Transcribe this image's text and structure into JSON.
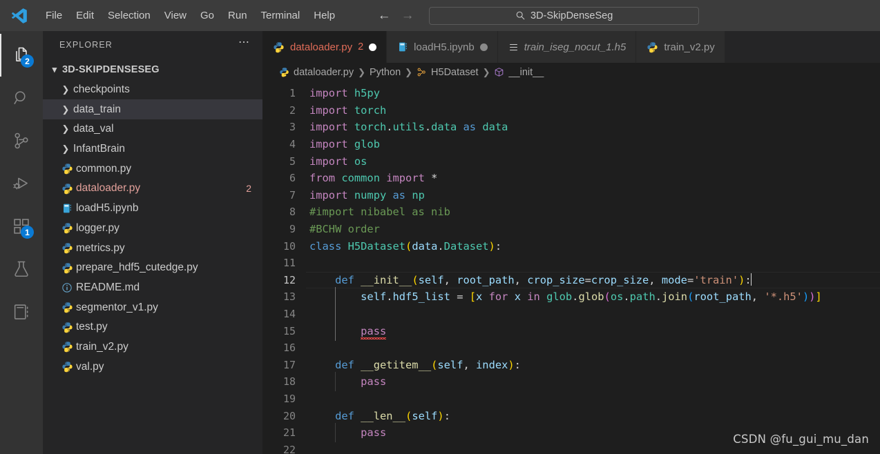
{
  "titlebar": {
    "logo_icon": "vscode-logo-icon",
    "menus": [
      "File",
      "Edit",
      "Selection",
      "View",
      "Go",
      "Run",
      "Terminal",
      "Help"
    ],
    "nav_back_icon": "arrow-left-icon",
    "nav_forward_icon": "arrow-right-icon",
    "quickinput": {
      "search_icon": "search-icon",
      "value": "3D-SkipDenseSeg"
    }
  },
  "activitybar": {
    "items": [
      {
        "name": "explorer",
        "icon": "files-icon",
        "badge": "2",
        "active": true
      },
      {
        "name": "search",
        "icon": "search-icon",
        "badge": "",
        "active": false
      },
      {
        "name": "source-control",
        "icon": "source-control-icon",
        "badge": "",
        "active": false
      },
      {
        "name": "run-debug",
        "icon": "run-and-debug-icon",
        "badge": "",
        "active": false
      },
      {
        "name": "extensions",
        "icon": "extensions-icon",
        "badge": "1",
        "active": false
      },
      {
        "name": "testing",
        "icon": "beaker-icon",
        "badge": "",
        "active": false
      },
      {
        "name": "notebook",
        "icon": "notebook-icon",
        "badge": "",
        "active": false
      }
    ]
  },
  "sidebar": {
    "title": "EXPLORER",
    "actions_icon": "more-actions-icon",
    "root": {
      "label": "3D-SKIPDENSESEG",
      "chevron": "chevron-down-icon",
      "expanded": true
    },
    "items": [
      {
        "label": "checkpoints",
        "kind": "folder",
        "icon": "chevron-right-icon",
        "selected": false,
        "modified": false,
        "count": ""
      },
      {
        "label": "data_train",
        "kind": "folder",
        "icon": "chevron-right-icon",
        "selected": true,
        "modified": false,
        "count": ""
      },
      {
        "label": "data_val",
        "kind": "folder",
        "icon": "chevron-right-icon",
        "selected": false,
        "modified": false,
        "count": ""
      },
      {
        "label": "InfantBrain",
        "kind": "folder",
        "icon": "chevron-right-icon",
        "selected": false,
        "modified": false,
        "count": ""
      },
      {
        "label": "common.py",
        "kind": "file",
        "icon": "python-icon",
        "selected": false,
        "modified": false,
        "count": ""
      },
      {
        "label": "dataloader.py",
        "kind": "file",
        "icon": "python-icon",
        "selected": false,
        "modified": true,
        "count": "2"
      },
      {
        "label": "loadH5.ipynb",
        "kind": "file",
        "icon": "notebook-file-icon",
        "selected": false,
        "modified": false,
        "count": ""
      },
      {
        "label": "logger.py",
        "kind": "file",
        "icon": "python-icon",
        "selected": false,
        "modified": false,
        "count": ""
      },
      {
        "label": "metrics.py",
        "kind": "file",
        "icon": "python-icon",
        "selected": false,
        "modified": false,
        "count": ""
      },
      {
        "label": "prepare_hdf5_cutedge.py",
        "kind": "file",
        "icon": "python-icon",
        "selected": false,
        "modified": false,
        "count": ""
      },
      {
        "label": "README.md",
        "kind": "file",
        "icon": "info-icon",
        "selected": false,
        "modified": false,
        "count": ""
      },
      {
        "label": "segmentor_v1.py",
        "kind": "file",
        "icon": "python-icon",
        "selected": false,
        "modified": false,
        "count": ""
      },
      {
        "label": "test.py",
        "kind": "file",
        "icon": "python-icon",
        "selected": false,
        "modified": false,
        "count": ""
      },
      {
        "label": "train_v2.py",
        "kind": "file",
        "icon": "python-icon",
        "selected": false,
        "modified": false,
        "count": ""
      },
      {
        "label": "val.py",
        "kind": "file",
        "icon": "python-icon",
        "selected": false,
        "modified": false,
        "count": ""
      }
    ]
  },
  "editor": {
    "tabs": [
      {
        "label": "dataloader.py",
        "icon": "python-icon",
        "active": true,
        "italic": false,
        "count": "2",
        "dot": "#ffffff"
      },
      {
        "label": "loadH5.ipynb",
        "icon": "notebook-file-icon",
        "active": false,
        "italic": false,
        "count": "",
        "dot": "#8a8a8a"
      },
      {
        "label": "train_iseg_nocut_1.h5",
        "icon": "binary-file-icon",
        "active": false,
        "italic": true,
        "count": "",
        "dot": ""
      },
      {
        "label": "train_v2.py",
        "icon": "python-icon",
        "active": false,
        "italic": false,
        "count": "",
        "dot": ""
      }
    ],
    "breadcrumb": [
      {
        "label": "dataloader.py",
        "icon": "python-icon"
      },
      {
        "label": "Python",
        "icon": ""
      },
      {
        "label": "H5Dataset",
        "icon": "class-icon"
      },
      {
        "label": "__init__",
        "icon": "method-icon"
      }
    ],
    "watermark": "CSDN @fu_gui_mu_dan",
    "language": "Python",
    "code_lines": [
      {
        "n": "1",
        "text": "import h5py"
      },
      {
        "n": "2",
        "text": "import torch"
      },
      {
        "n": "3",
        "text": "import torch.utils.data as data"
      },
      {
        "n": "4",
        "text": "import glob"
      },
      {
        "n": "5",
        "text": "import os"
      },
      {
        "n": "6",
        "text": "from common import *"
      },
      {
        "n": "7",
        "text": "import numpy as np"
      },
      {
        "n": "8",
        "text": "#import nibabel as nib"
      },
      {
        "n": "9",
        "text": "#BCHW order"
      },
      {
        "n": "10",
        "text": "class H5Dataset(data.Dataset):"
      },
      {
        "n": "11",
        "text": ""
      },
      {
        "n": "12",
        "text": "    def __init__(self, root_path, crop_size=crop_size, mode='train'):"
      },
      {
        "n": "13",
        "text": "        self.hdf5_list = [x for x in glob.glob(os.path.join(root_path, '*.h5'))]"
      },
      {
        "n": "14",
        "text": ""
      },
      {
        "n": "15",
        "text": "        pass"
      },
      {
        "n": "16",
        "text": ""
      },
      {
        "n": "17",
        "text": "    def __getitem__(self, index):"
      },
      {
        "n": "18",
        "text": "        pass"
      },
      {
        "n": "19",
        "text": ""
      },
      {
        "n": "20",
        "text": "    def __len__(self):"
      },
      {
        "n": "21",
        "text": "        pass"
      },
      {
        "n": "22",
        "text": ""
      }
    ],
    "cursor_line": "12"
  },
  "colors": {
    "titlebar_bg": "#3c3c3c",
    "activitybar_bg": "#333333",
    "sidebar_bg": "#252526",
    "editor_bg": "#1e1e1e",
    "tab_inactive_bg": "#2d2d2d",
    "badge_bg": "#0a7ad4",
    "modified_fg": "#e06c58",
    "selection_bg": "#37373d",
    "error_squiggle": "#f14c4c"
  }
}
